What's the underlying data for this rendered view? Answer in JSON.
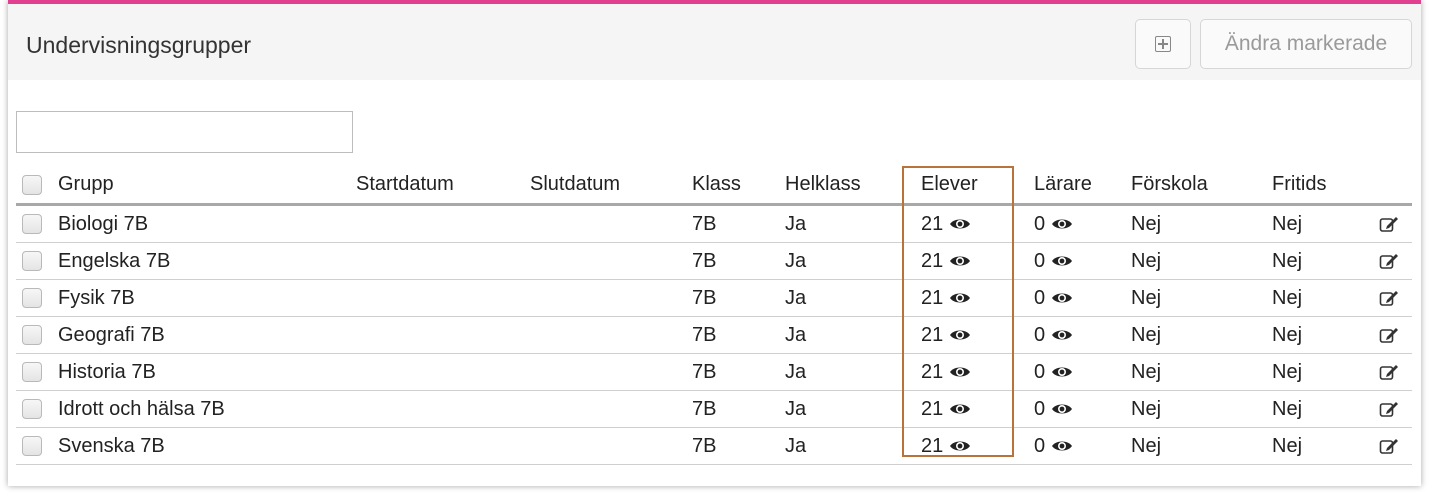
{
  "page": {
    "title": "Undervisningsgrupper",
    "edit_selected_label": "Ändra markerade",
    "accent_color": "#e0408f",
    "highlight_color": "#b9733a"
  },
  "search": {
    "value": "",
    "placeholder": ""
  },
  "table": {
    "headers": {
      "grupp": "Grupp",
      "startdatum": "Startdatum",
      "slutdatum": "Slutdatum",
      "klass": "Klass",
      "helklass": "Helklass",
      "elever": "Elever",
      "larare": "Lärare",
      "forskola": "Förskola",
      "fritids": "Fritids"
    },
    "rows": [
      {
        "grupp": "Biologi 7B",
        "startdatum": "",
        "slutdatum": "",
        "klass": "7B",
        "helklass": "Ja",
        "elever": "21",
        "larare": "0",
        "forskola": "Nej",
        "fritids": "Nej"
      },
      {
        "grupp": "Engelska 7B",
        "startdatum": "",
        "slutdatum": "",
        "klass": "7B",
        "helklass": "Ja",
        "elever": "21",
        "larare": "0",
        "forskola": "Nej",
        "fritids": "Nej"
      },
      {
        "grupp": "Fysik 7B",
        "startdatum": "",
        "slutdatum": "",
        "klass": "7B",
        "helklass": "Ja",
        "elever": "21",
        "larare": "0",
        "forskola": "Nej",
        "fritids": "Nej"
      },
      {
        "grupp": "Geografi 7B",
        "startdatum": "",
        "slutdatum": "",
        "klass": "7B",
        "helklass": "Ja",
        "elever": "21",
        "larare": "0",
        "forskola": "Nej",
        "fritids": "Nej"
      },
      {
        "grupp": "Historia 7B",
        "startdatum": "",
        "slutdatum": "",
        "klass": "7B",
        "helklass": "Ja",
        "elever": "21",
        "larare": "0",
        "forskola": "Nej",
        "fritids": "Nej"
      },
      {
        "grupp": "Idrott och hälsa 7B",
        "startdatum": "",
        "slutdatum": "",
        "klass": "7B",
        "helklass": "Ja",
        "elever": "21",
        "larare": "0",
        "forskola": "Nej",
        "fritids": "Nej"
      },
      {
        "grupp": "Svenska 7B",
        "startdatum": "",
        "slutdatum": "",
        "klass": "7B",
        "helklass": "Ja",
        "elever": "21",
        "larare": "0",
        "forskola": "Nej",
        "fritids": "Nej"
      }
    ]
  },
  "icons": {
    "add": "plus-square-icon",
    "view": "eye-icon",
    "edit": "edit-icon",
    "select": "checkbox"
  }
}
